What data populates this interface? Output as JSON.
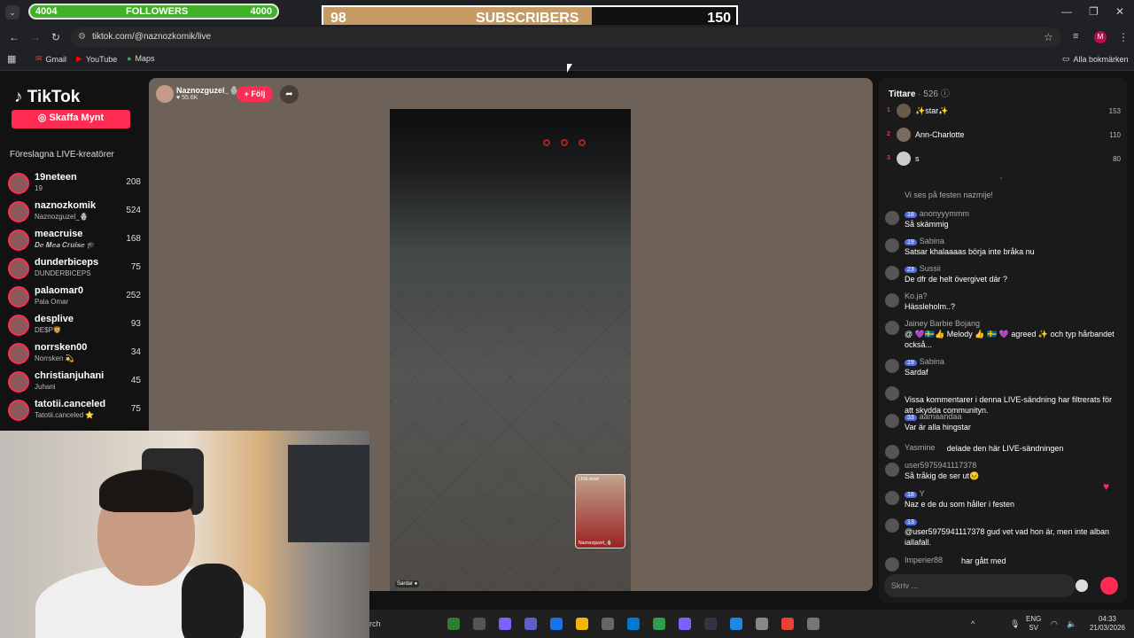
{
  "overlay": {
    "followers": {
      "current": "4004",
      "label": "FOLLOWERS",
      "goal": "4000",
      "progress": 1.0
    },
    "subscribers": {
      "current": "98",
      "label": "SUBSCRIBERS",
      "goal": "150",
      "progress": 0.65
    }
  },
  "browser": {
    "url": "tiktok.com/@naznozkomik/live",
    "bookmarks": [
      "Gmail",
      "YouTube",
      "Maps"
    ],
    "all_bookmarks": "Alla bokmärken"
  },
  "sidebar": {
    "logo": "TikTok",
    "coins_button": "Skaffa Mynt",
    "section_title": "Föreslagna LIVE-kreatörer",
    "creators": [
      {
        "name": "19neteen",
        "sub": "19",
        "count": "208"
      },
      {
        "name": "naznozkomik",
        "sub": "Naznozguzel_🪬",
        "count": "524"
      },
      {
        "name": "meacruise",
        "sub": "𝑫𝒆 𝑴𝒆𝒂 𝑪𝒓𝒖𝒊𝒔𝒆 🎓",
        "count": "168"
      },
      {
        "name": "dunderbiceps",
        "sub": "DUNDERBICEPS",
        "count": "75"
      },
      {
        "name": "palaomar0",
        "sub": "Pala Omar",
        "count": "252"
      },
      {
        "name": "desplive",
        "sub": "DE$P🦁",
        "count": "93"
      },
      {
        "name": "norrsken00",
        "sub": "Norrsken 💫",
        "count": "34"
      },
      {
        "name": "christianjuhani",
        "sub": "Juhani",
        "count": "45"
      },
      {
        "name": "tatotii.canceled",
        "sub": "Tatotii.canceled ⭐",
        "count": "75"
      }
    ]
  },
  "stream": {
    "host_name": "Naznozguzel_🪬",
    "host_likes": "♥ 55.6K",
    "follow_label": "+ Följ",
    "pip_label": "LIVE-bowl",
    "pip_name": "Naznozguzel_🪬",
    "cam_tag": "Sardar ●"
  },
  "chat": {
    "viewers_label": "Tittare",
    "viewers_count": "· 526",
    "top_viewers": [
      {
        "rank": "1",
        "name": "✨star✨",
        "points": "153"
      },
      {
        "rank": "2",
        "name": "Ann-Charlotte",
        "points": "110"
      },
      {
        "rank": "3",
        "name": "s",
        "points": "80"
      }
    ],
    "messages": [
      {
        "user": "",
        "badge": "",
        "text": "Vi ses på festen nazmije!"
      },
      {
        "user": "anonyyymmm",
        "badge": "18",
        "text": "Så skämmig"
      },
      {
        "user": "Sabina",
        "badge": "19",
        "text": "Satsar khalaaaas börja inte bråka nu"
      },
      {
        "user": "Sussii",
        "badge": "23",
        "text": "De dfr de helt övergivet där ?"
      },
      {
        "user": "Ko.ja?",
        "badge": "",
        "text": "Hässleholm..?"
      },
      {
        "user": "Jainey Barbie Bojang",
        "badge": "",
        "text": "@ 💜🇸🇪👍 Melody 👍 🇸🇪 💜 agreed ✨ och typ hårbandet också..."
      },
      {
        "user": "Sabina",
        "badge": "19",
        "text": "Sardaf"
      },
      {
        "user": "",
        "badge": "",
        "text": "Vissa kommentarer i denna LIVE-sändning har filtrerats för att skydda communityn."
      },
      {
        "user": "aamaandaa",
        "badge": "33",
        "text": "Var är alla hingstar"
      },
      {
        "user": "Yasmine",
        "badge": "",
        "text": "delade den här LIVE-sändningen"
      },
      {
        "user": "user5975941117378",
        "badge": "",
        "text": "Så tråkig de ser ut😣"
      },
      {
        "user": "Y",
        "badge": "18",
        "text": "Naz e de du som håller i festen"
      },
      {
        "user": "",
        "badge": "13",
        "text": "@user5975941117378 gud vet vad hon är, men inte alban iallafall."
      },
      {
        "user": "Imperier88",
        "badge": "",
        "text": "har gått med"
      }
    ],
    "input_placeholder": "Skriv ..."
  },
  "taskbar": {
    "search": "rch",
    "lang": "ENG",
    "lang_sub": "SV",
    "time": "04:33",
    "date": "21/03/2026"
  },
  "colors": {
    "tiktok_red": "#fe2c55",
    "followers_green": "#43b02a",
    "subs_gold": "#c69a63"
  }
}
